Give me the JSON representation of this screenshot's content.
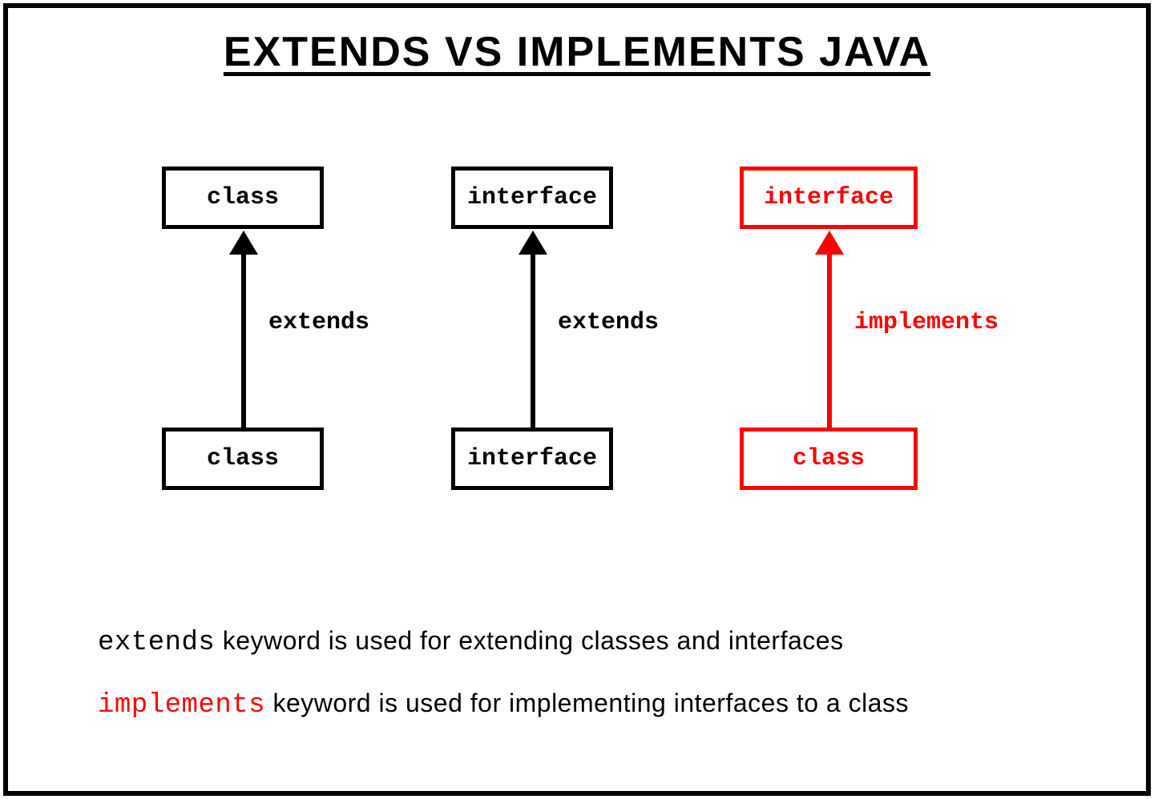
{
  "title": "EXTENDS VS IMPLEMENTS JAVA",
  "columns": [
    {
      "top": "class",
      "bottom": "class",
      "relation": "extends",
      "color": "black"
    },
    {
      "top": "interface",
      "bottom": "interface",
      "relation": "extends",
      "color": "black"
    },
    {
      "top": "interface",
      "bottom": "class",
      "relation": "implements",
      "color": "red"
    }
  ],
  "descriptions": [
    {
      "keyword": "extends",
      "text": " keyword is used for extending classes and interfaces",
      "keyword_color": "black"
    },
    {
      "keyword": "implements",
      "text": " keyword is used for implementing interfaces to a class",
      "keyword_color": "red"
    }
  ]
}
